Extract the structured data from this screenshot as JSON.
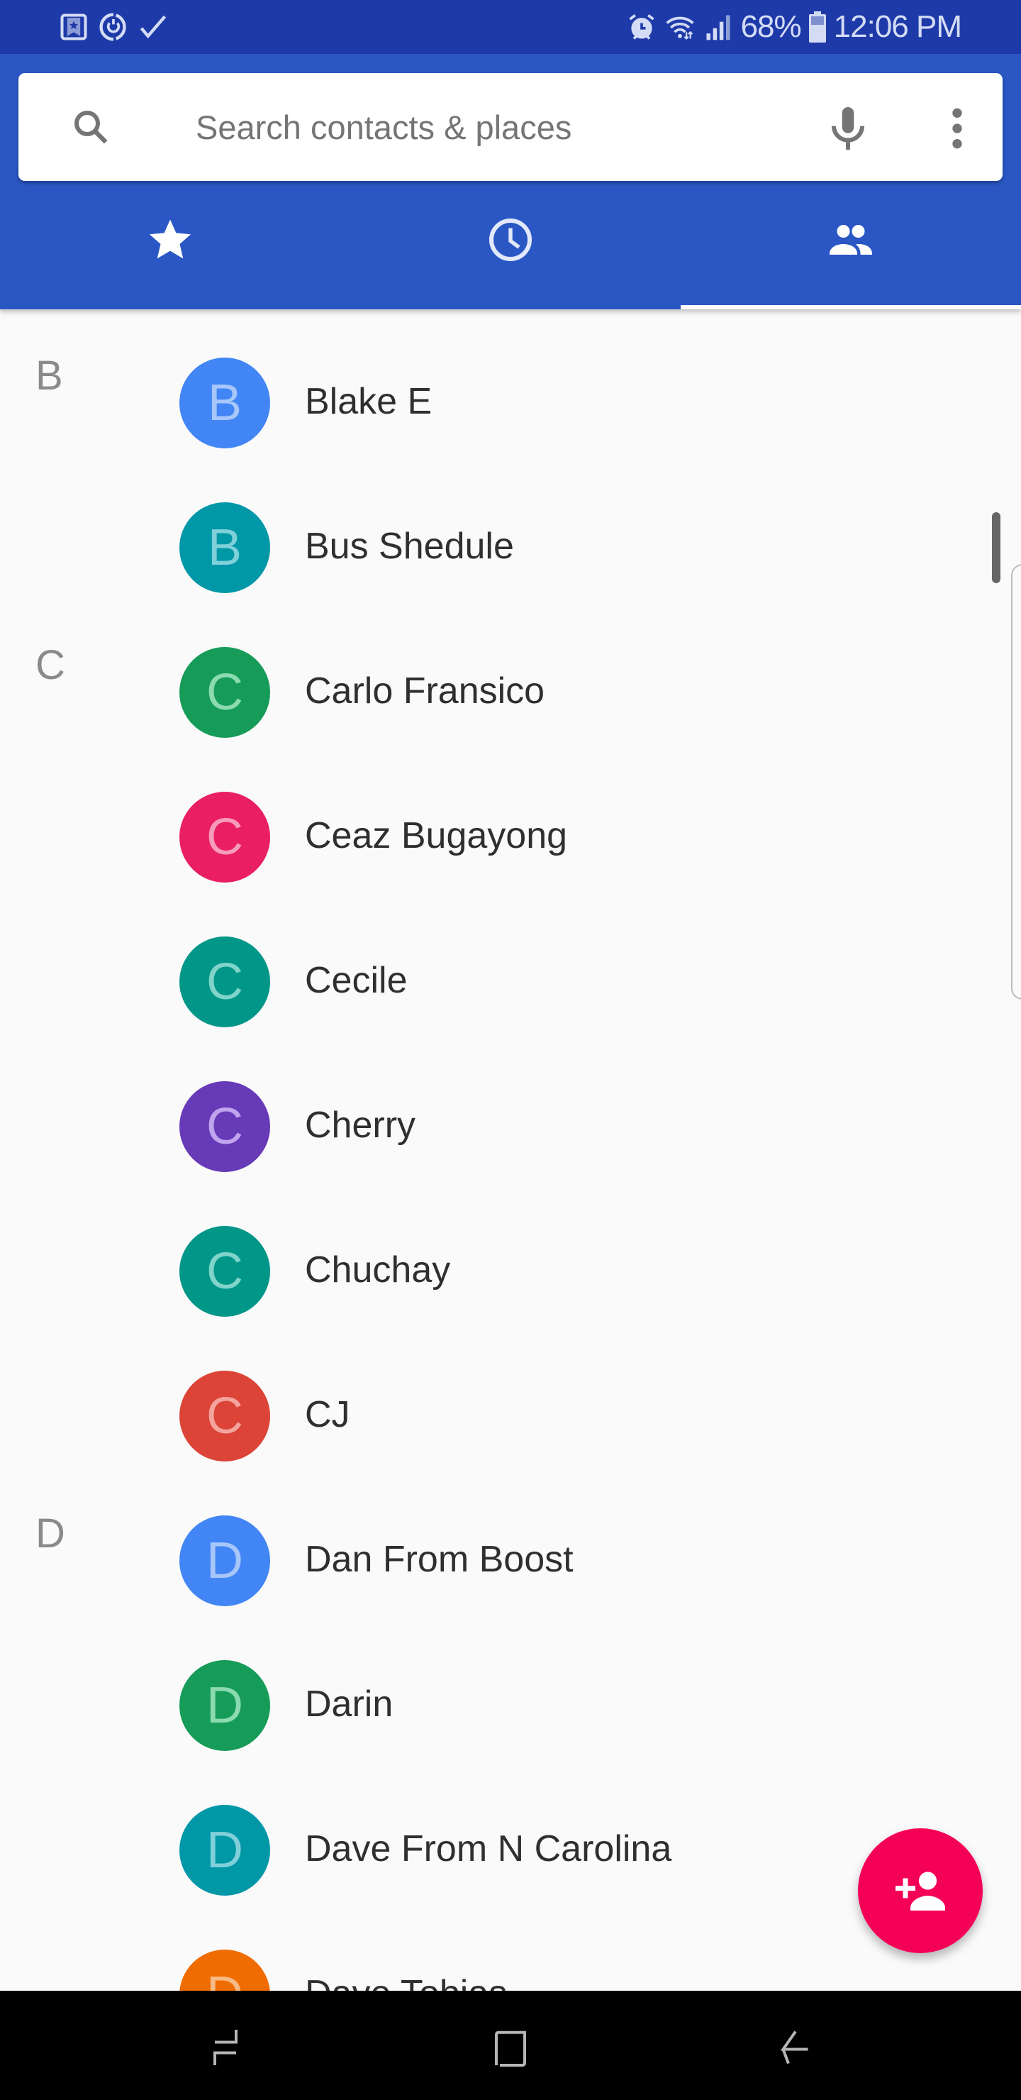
{
  "status_bar": {
    "left_icons": [
      "bookmark-star-icon",
      "sync-icon",
      "check-icon"
    ],
    "right_icons": [
      "alarm-icon",
      "wifi-icon",
      "signal-icon"
    ],
    "battery_percent": "68%",
    "battery_icon": "battery-icon",
    "time": "12:06 PM"
  },
  "search": {
    "placeholder": "Search contacts & places",
    "value": "",
    "search_icon": "search-icon",
    "mic_icon": "mic-icon",
    "more_icon": "more-vert-icon"
  },
  "tabs": [
    {
      "name": "favorites",
      "icon": "star-icon",
      "selected": false
    },
    {
      "name": "recents",
      "icon": "clock-icon",
      "selected": false
    },
    {
      "name": "contacts",
      "icon": "people-icon",
      "selected": true
    }
  ],
  "contacts": [
    {
      "section": "B",
      "initial": "B",
      "name": "Blake E",
      "color": "#4285F4",
      "letter_color": "#A7C6FA"
    },
    {
      "section": "",
      "initial": "B",
      "name": "Bus Shedule",
      "color": "#0097A7",
      "letter_color": "#80D0DA"
    },
    {
      "section": "C",
      "initial": "C",
      "name": "Carlo Fransico",
      "color": "#169C58",
      "letter_color": "#8CDAB0"
    },
    {
      "section": "",
      "initial": "C",
      "name": "Ceaz Bugayong",
      "color": "#E91E63",
      "letter_color": "#F79BBC"
    },
    {
      "section": "",
      "initial": "C",
      "name": "Cecile",
      "color": "#009688",
      "letter_color": "#80D4CA"
    },
    {
      "section": "",
      "initial": "C",
      "name": "Cherry",
      "color": "#673AB7",
      "letter_color": "#C0A5EE"
    },
    {
      "section": "",
      "initial": "C",
      "name": "Chuchay",
      "color": "#009688",
      "letter_color": "#80D4CA"
    },
    {
      "section": "",
      "initial": "C",
      "name": "CJ",
      "color": "#DB4437",
      "letter_color": "#F4A49C"
    },
    {
      "section": "D",
      "initial": "D",
      "name": "Dan From Boost",
      "color": "#4285F4",
      "letter_color": "#A7C6FA"
    },
    {
      "section": "",
      "initial": "D",
      "name": "Darin",
      "color": "#169C58",
      "letter_color": "#8CDAB0"
    },
    {
      "section": "",
      "initial": "D",
      "name": "Dave From N Carolina",
      "color": "#0097A7",
      "letter_color": "#80D0DA"
    },
    {
      "section": "",
      "initial": "D",
      "name": "Dave Tobias",
      "color": "#EF6C00",
      "letter_color": "#F8BB85"
    }
  ],
  "fab": {
    "icon": "add-person-icon",
    "color": "#F50057"
  },
  "nav_bar": {
    "buttons": [
      {
        "name": "recent-apps",
        "icon": "recent-apps-icon"
      },
      {
        "name": "home",
        "icon": "home-icon"
      },
      {
        "name": "back",
        "icon": "back-icon"
      }
    ]
  },
  "colors": {
    "status_bar": "#1E3AA8",
    "header": "#2B57C5",
    "background": "#FAFAFA"
  }
}
